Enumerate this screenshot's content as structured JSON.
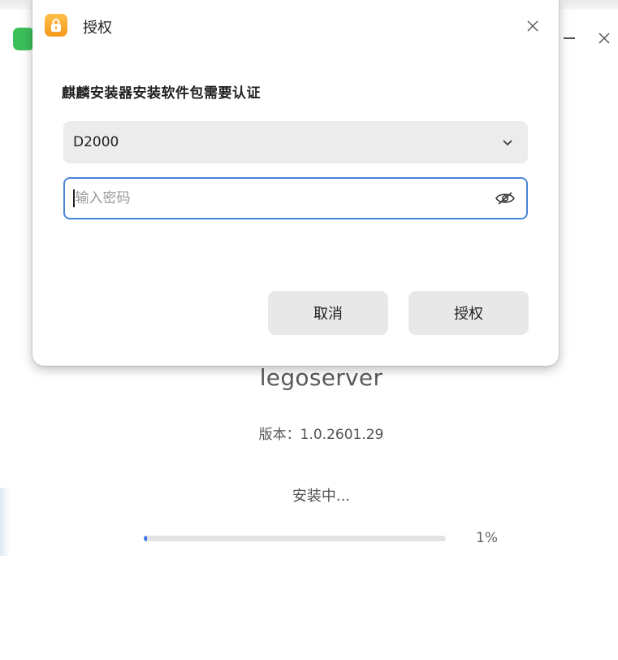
{
  "installer": {
    "app_name": "legoserver",
    "version": "版本：1.0.2601.29",
    "status": "安装中...",
    "progress_percent_text": "1%",
    "progress_value": 0.01
  },
  "dialog": {
    "title": "授权",
    "message": "麒麟安装器安装软件包需要认证",
    "user_select_value": "D2000",
    "password_placeholder": "输入密码",
    "cancel_label": "取消",
    "authorize_label": "授权"
  },
  "colors": {
    "accent": "#4a86d6",
    "lock_icon": "#f7a52a",
    "app_icon": "#3bbf5a",
    "progress": "#3b78e7"
  },
  "icons": {
    "dialog_icon": "lock-icon",
    "close": "close-icon",
    "select": "chevron-down-icon",
    "password_toggle": "eye-slash-icon",
    "window_minimize": "minimize-icon",
    "window_close": "close-icon"
  }
}
